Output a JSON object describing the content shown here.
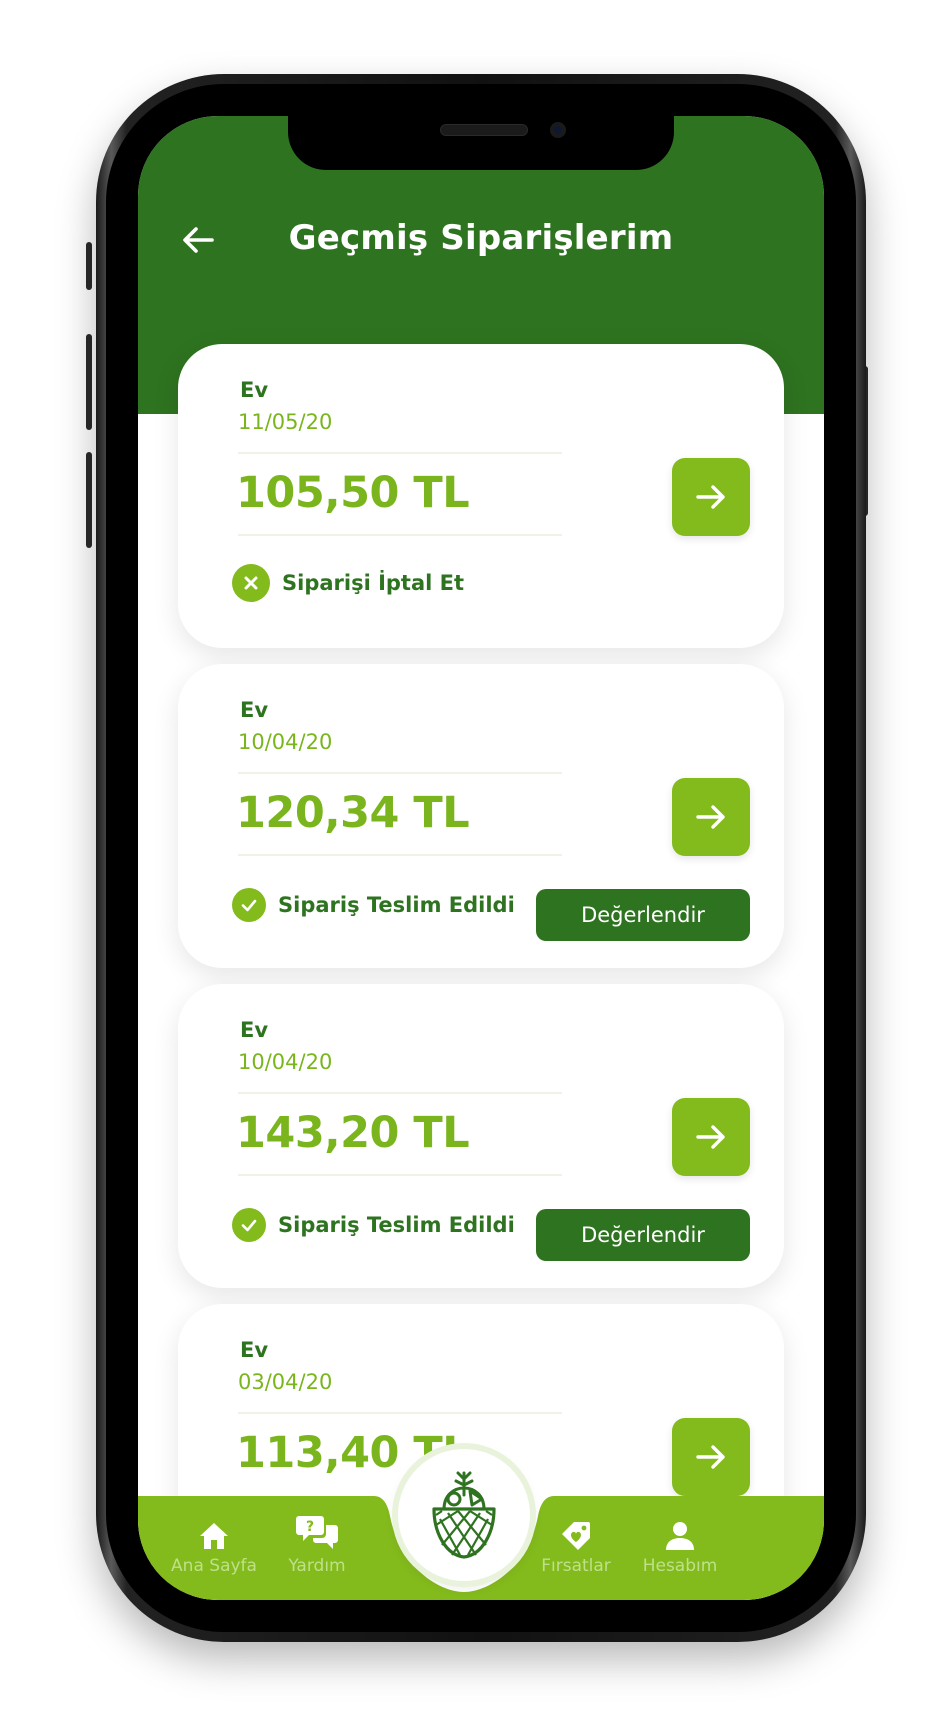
{
  "header": {
    "title": "Geçmiş Siparişlerim"
  },
  "orders": [
    {
      "address": "Ev",
      "date": "11/05/20",
      "amount": "105,50 TL",
      "status": "Siparişi İptal Et",
      "status_type": "cancel",
      "rate_label": ""
    },
    {
      "address": "Ev",
      "date": "10/04/20",
      "amount": "120,34 TL",
      "status": "Sipariş Teslim Edildi",
      "status_type": "delivered",
      "rate_label": "Değerlendir"
    },
    {
      "address": "Ev",
      "date": "10/04/20",
      "amount": "143,20 TL",
      "status": "Sipariş Teslim Edildi",
      "status_type": "delivered",
      "rate_label": "Değerlendir"
    },
    {
      "address": "Ev",
      "date": "03/04/20",
      "amount": "113,40 TL"
    }
  ],
  "nav": {
    "items": [
      {
        "label": "Ana Sayfa",
        "icon": "home-icon"
      },
      {
        "label": "Yardım",
        "icon": "help-chat-icon"
      },
      {
        "label": "Fırsatlar",
        "icon": "tag-heart-icon"
      },
      {
        "label": "Hesabım",
        "icon": "user-icon"
      }
    ],
    "center_icon": "basket-icon"
  },
  "colors": {
    "header": "#2e7320",
    "accent": "#83ba1c",
    "amount": "#7ab51d",
    "dark_green": "#2e7320",
    "nav": "#83ba1c"
  }
}
